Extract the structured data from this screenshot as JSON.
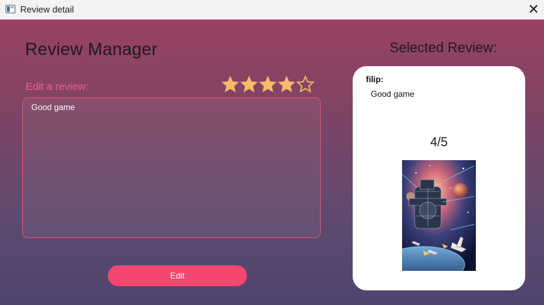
{
  "window": {
    "title": "Review detail",
    "close_label": "✕"
  },
  "app": {
    "heading": "Review Manager"
  },
  "editor": {
    "label": "Edit a review:",
    "text": "Good game",
    "rating": 4,
    "rating_max": 5,
    "button_label": "Edit"
  },
  "selected": {
    "heading": "Selected Review:",
    "user": "filip:",
    "text": "Good game",
    "rating_text": "4/5"
  },
  "colors": {
    "accent": "#f2476e",
    "star": "#f7b96b",
    "label": "#f25f85"
  }
}
